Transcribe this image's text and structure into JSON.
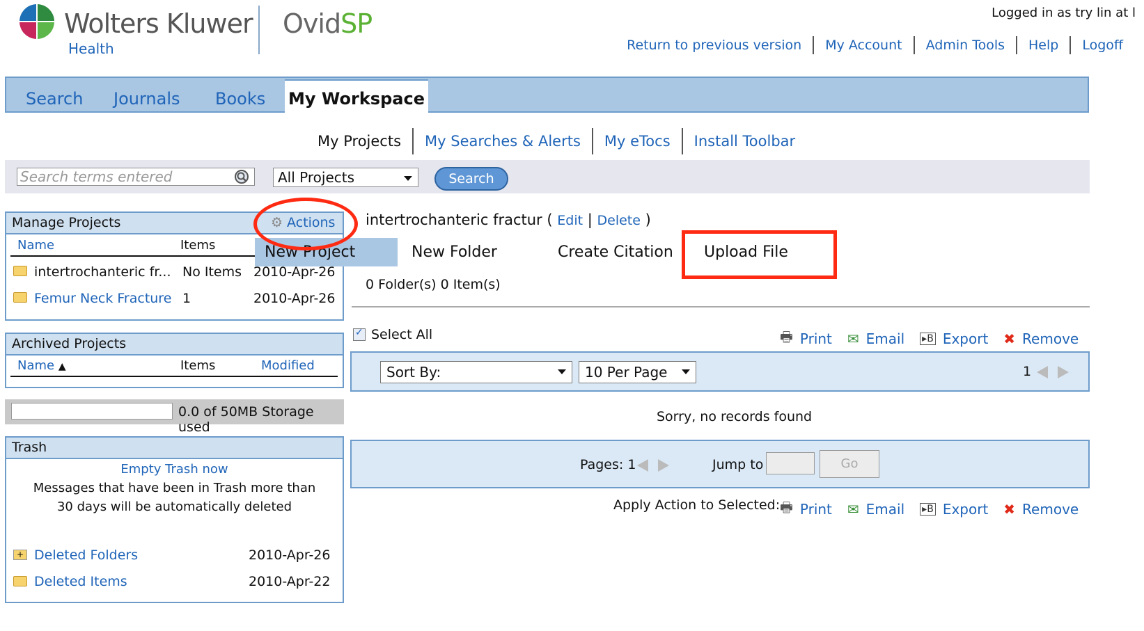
{
  "header": {
    "brand_name": "Wolters Kluwer",
    "brand_sub": "Health",
    "product_prefix": "Ovid",
    "product_suffix": "SP",
    "logged_in": "Logged in as try lin at l",
    "links": [
      "Return to previous version",
      "My Account",
      "Admin Tools",
      "Help",
      "Logoff"
    ]
  },
  "tabs": {
    "search": "Search",
    "journals": "Journals",
    "books": "Books",
    "my_workspace": "My Workspace"
  },
  "subnav": [
    "My Projects",
    "My Searches & Alerts",
    "My eTocs",
    "Install Toolbar"
  ],
  "searchbar": {
    "placeholder": "Search terms entered",
    "scope": "All Projects",
    "button": "Search"
  },
  "manage_projects": {
    "title": "Manage Projects",
    "actions_label": "Actions",
    "col_name": "Name",
    "col_items": "Items",
    "rows": [
      {
        "name": "intertrochanteric fr...",
        "items": "No Items",
        "date": "2010-Apr-26"
      },
      {
        "name": "Femur Neck Fracture",
        "items": "1",
        "date": "2010-Apr-26"
      }
    ]
  },
  "actions_menu": {
    "new_project": "New Project",
    "new_folder": "New Folder",
    "create_citation": "Create Citation",
    "upload_file": "Upload File"
  },
  "archived_projects": {
    "title": "Archived Projects",
    "col_name": "Name",
    "sort_arrow": "▲",
    "col_items": "Items",
    "col_modified": "Modified"
  },
  "storage": {
    "text": "0.0 of 50MB Storage used",
    "used_fraction": 0
  },
  "trash": {
    "title": "Trash",
    "empty_link": "Empty Trash now",
    "message_line1": "Messages that have been in Trash more than",
    "message_line2": "30 days will be automatically deleted",
    "rows": [
      {
        "name": "Deleted Folders",
        "date": "2010-Apr-26"
      },
      {
        "name": "Deleted Items",
        "date": "2010-Apr-22"
      }
    ]
  },
  "project": {
    "title": "intertrochanteric fractur",
    "open_paren": "(",
    "edit": "Edit",
    "sep": "|",
    "delete": "Delete",
    "close_paren": ")",
    "counts": "0 Folder(s) 0 Item(s)"
  },
  "results": {
    "select_all": "Select All",
    "actions": [
      "Print",
      "Email",
      "Export",
      "Remove"
    ],
    "sort_by": "Sort By:",
    "per_page": "10 Per Page",
    "page_num": "1",
    "empty_message": "Sorry, no records found",
    "pages_label": "Pages: 1",
    "jump_label": "Jump to",
    "go": "Go",
    "apply_label": "Apply Action to Selected:"
  },
  "colors": {
    "link": "#1f64b8",
    "tab_bar": "#a9c6e3",
    "annotation_red": "#ff2a12"
  }
}
